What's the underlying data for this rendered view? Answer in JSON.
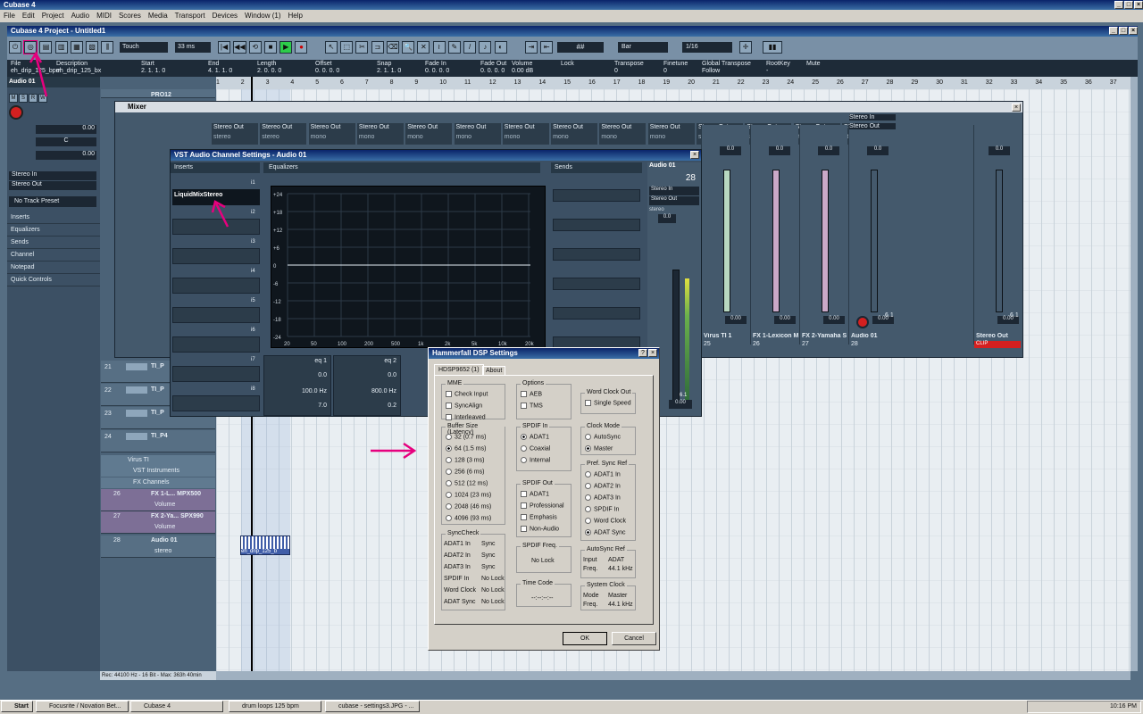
{
  "app": {
    "title": "Cubase 4",
    "project_title": "Cubase 4 Project - Untitled1"
  },
  "menu": [
    "File",
    "Edit",
    "Project",
    "Audio",
    "MIDI",
    "Scores",
    "Media",
    "Transport",
    "Devices",
    "Window (1)",
    "Help"
  ],
  "toolbar": {
    "mode": "Touch",
    "latency": "33 ms",
    "snap": "Bar",
    "quant": "1/16"
  },
  "infoline": {
    "headers": [
      "File",
      "Description",
      "Start",
      "End",
      "Length",
      "Offset",
      "Snap",
      "Fade In",
      "Fade Out",
      "Volume",
      "Lock",
      "Transpose",
      "Finetune",
      "Global Transpose",
      "RootKey",
      "Mute"
    ],
    "values": [
      "eh_drip_125_bpm",
      "eh_drip_125_bx",
      "2. 1. 1. 0",
      "4. 1. 1. 0",
      "2. 0. 0. 0",
      "0. 0. 0. 0",
      "2. 1. 1. 0",
      "0. 0. 0. 0",
      "0. 0. 0. 0",
      "0.00 dB",
      "",
      "0",
      "0",
      "Follow",
      "-",
      ""
    ]
  },
  "ruler": [
    "1",
    "2",
    "3",
    "4",
    "5",
    "6",
    "7",
    "8",
    "9",
    "10",
    "11",
    "12",
    "13",
    "14",
    "15",
    "16",
    "17",
    "18",
    "19",
    "20",
    "21",
    "22",
    "23",
    "24",
    "25",
    "26",
    "27",
    "28",
    "29",
    "30",
    "31",
    "32",
    "33",
    "34",
    "35",
    "36",
    "37"
  ],
  "inspector": {
    "track": "Audio 01",
    "vol": "0.00",
    "pan": "C",
    "delay": "0.00",
    "in": "Stereo In",
    "out": "Stereo Out",
    "preset": "No Track Preset",
    "sections": [
      "Inserts",
      "Equalizers",
      "Sends",
      "Channel",
      "Notepad",
      "Quick Controls"
    ]
  },
  "tracks": [
    {
      "num": "",
      "name": "PRO12"
    },
    {
      "num": "21",
      "name": "TI_P"
    },
    {
      "num": "22",
      "name": "TI_P"
    },
    {
      "num": "23",
      "name": "TI_P"
    },
    {
      "num": "24",
      "name": "TI_P4"
    }
  ],
  "folders": [
    "Virus TI",
    "VST Instruments",
    "FX Channels"
  ],
  "fxtracks": [
    {
      "num": "26",
      "name": "FX 1-L... MPX500",
      "sub": "Volume"
    },
    {
      "num": "27",
      "name": "FX 2-Ya... SPX990",
      "sub": "Volume"
    },
    {
      "num": "28",
      "name": "Audio 01",
      "sub": "stereo"
    }
  ],
  "event": {
    "name": "eh_drip_125_b"
  },
  "status": "Rec: 44100 Hz - 16 Bit - Max: 363h 40min",
  "mixer": {
    "title": "Mixer",
    "channels": [
      {
        "out": "Stereo Out",
        "fmt": "stereo"
      },
      {
        "out": "Stereo Out",
        "fmt": "stereo"
      },
      {
        "out": "Stereo Out",
        "fmt": "mono"
      },
      {
        "out": "Stereo Out",
        "fmt": "mono"
      },
      {
        "out": "Stereo Out",
        "fmt": "mono"
      },
      {
        "out": "Stereo Out",
        "fmt": "mono"
      },
      {
        "out": "Stereo Out",
        "fmt": "mono"
      },
      {
        "out": "Stereo Out",
        "fmt": "mono"
      },
      {
        "out": "Stereo Out",
        "fmt": "mono"
      },
      {
        "out": "Stereo Out",
        "fmt": "mono"
      },
      {
        "out": "Stereo Out",
        "fmt": "stereo"
      },
      {
        "out": "Stereo Out",
        "fmt": "stereo"
      },
      {
        "out": "Stereo Out",
        "fmt": "stereo"
      },
      {
        "out": "Stereo Out",
        "fmt": "stereo"
      }
    ],
    "strips": [
      {
        "name": "Virus TI 1",
        "num": "25",
        "val": "0.00"
      },
      {
        "name": "FX 1-Lexicon M",
        "num": "26",
        "val": "0.00"
      },
      {
        "name": "FX 2-Yamaha S",
        "num": "27",
        "val": "0.00"
      },
      {
        "name": "Audio 01",
        "num": "28",
        "val": "0.00",
        "peak": "6.1",
        "in": "Stereo In",
        "out": "Stereo Out"
      },
      {
        "name": "Stereo Out",
        "num": "",
        "val": "0.00",
        "peak": "6.1",
        "clip": "CLIP"
      }
    ],
    "pan": "0.0"
  },
  "vst": {
    "title": "VST Audio Channel Settings - Audio 01",
    "inserts_label": "Inserts",
    "eq_label": "Equalizers",
    "sends_label": "Sends",
    "plugin": "LiquidMixStereo",
    "slots": [
      "i1",
      "i2",
      "i3",
      "i4",
      "i5",
      "i6",
      "i7",
      "i8"
    ],
    "eq_y": [
      "+24",
      "+18",
      "+12",
      "+6",
      "0",
      "-6",
      "-12",
      "-18",
      "-24"
    ],
    "eq_x": [
      "20",
      "50",
      "100",
      "200",
      "500",
      "1k",
      "2k",
      "5k",
      "10k",
      "20k"
    ],
    "eq_bands": [
      {
        "name": "eq 1",
        "gain": "0.0",
        "freq": "100.0 Hz",
        "q": "7.0"
      },
      {
        "name": "eq 2",
        "gain": "0.0",
        "freq": "800.0 Hz",
        "q": "0.2"
      }
    ],
    "channel": {
      "name": "Audio 01",
      "num": "28",
      "in": "Stereo In",
      "out": "Stereo Out",
      "fmt": "stereo",
      "pan": "0.0",
      "vol": "0.00",
      "peak": "6.1"
    }
  },
  "dsp": {
    "title": "Hammerfall DSP Settings",
    "tabs": [
      "HDSP9652 (1)",
      "About"
    ],
    "mme": {
      "label": "MME",
      "items": [
        "Check Input",
        "SyncAlign",
        "Interleaved"
      ]
    },
    "options": {
      "label": "Options",
      "items": [
        "AEB",
        "TMS"
      ]
    },
    "wordclock": {
      "label": "Word Clock Out",
      "items": [
        "Single Speed"
      ]
    },
    "buffer": {
      "label": "Buffer Size (Latency)",
      "items": [
        "32 (0.7 ms)",
        "64 (1.5 ms)",
        "128 (3 ms)",
        "256 (6 ms)",
        "512 (12 ms)",
        "1024 (23 ms)",
        "2048 (46 ms)",
        "4096 (93 ms)"
      ],
      "selected": 1
    },
    "spdif_in": {
      "label": "SPDIF In",
      "items": [
        "ADAT1",
        "Coaxial",
        "Internal"
      ],
      "selected": 0
    },
    "clock_mode": {
      "label": "Clock Mode",
      "items": [
        "AutoSync",
        "Master"
      ],
      "selected": 1
    },
    "spdif_out": {
      "label": "SPDIF Out",
      "items": [
        "ADAT1",
        "Professional",
        "Emphasis",
        "Non-Audio"
      ]
    },
    "pref_sync": {
      "label": "Pref. Sync Ref",
      "items": [
        "ADAT1 In",
        "ADAT2 In",
        "ADAT3 In",
        "SPDIF In",
        "Word Clock",
        "ADAT Sync"
      ],
      "selected": 5
    },
    "synccheck": {
      "label": "SyncCheck",
      "rows": [
        [
          "ADAT1 In",
          "Sync"
        ],
        [
          "ADAT2 In",
          "Sync"
        ],
        [
          "ADAT3 In",
          "Sync"
        ],
        [
          "SPDIF In",
          "No Lock"
        ],
        [
          "Word Clock",
          "No Lock"
        ],
        [
          "ADAT Sync",
          "No Lock"
        ]
      ]
    },
    "spdif_freq": {
      "label": "SPDIF Freq.",
      "value": "No Lock"
    },
    "autosync_ref": {
      "label": "AutoSync Ref",
      "rows": [
        [
          "Input",
          "ADAT"
        ],
        [
          "Freq.",
          "44.1 kHz"
        ]
      ]
    },
    "timecode": {
      "label": "Time Code",
      "value": "--:--:--:--"
    },
    "system_clock": {
      "label": "System Clock",
      "rows": [
        [
          "Mode",
          "Master"
        ],
        [
          "Freq.",
          "44.1 kHz"
        ]
      ]
    },
    "ok": "OK",
    "cancel": "Cancel"
  },
  "taskbar": {
    "start": "Start",
    "items": [
      "Focusrite / Novation Bet...",
      "Cubase 4",
      "drum loops 125 bpm",
      "cubase - settings3.JPG - ..."
    ],
    "clock": "10:16 PM"
  },
  "colors": {
    "accent": "#e6007e",
    "clip": "#d42020"
  }
}
